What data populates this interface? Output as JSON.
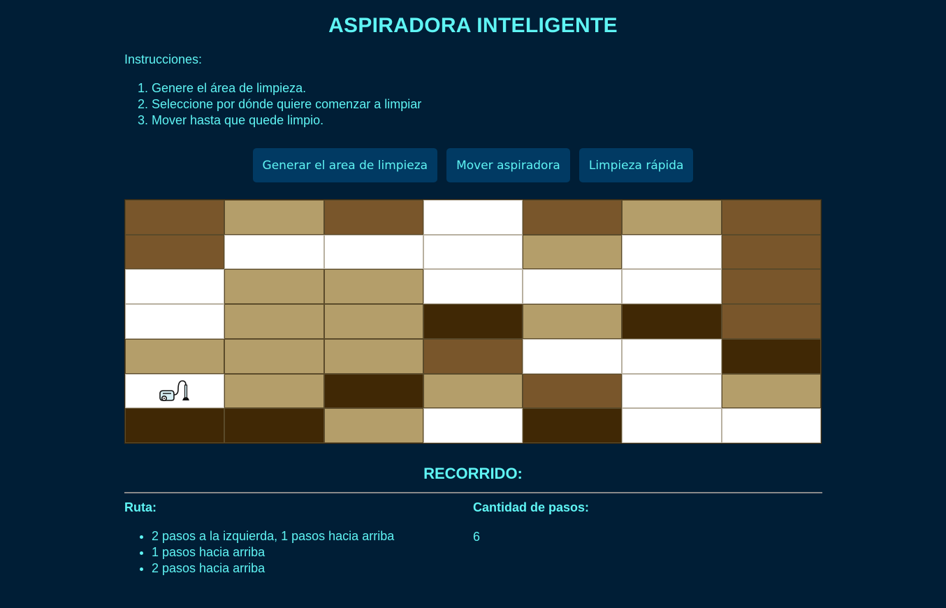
{
  "title": "ASPIRADORA INTELIGENTE",
  "instructions": {
    "label": "Instrucciones:",
    "steps": [
      "Genere el área de limpieza.",
      "Seleccione por dónde quiere comenzar a limpiar",
      "Mover hasta que quede limpio."
    ]
  },
  "buttons": {
    "generate": "Generar el area de limpieza",
    "move": "Mover aspiradora",
    "fast_clean": "Limpieza rápida"
  },
  "colors": {
    "background": "#001e36",
    "text": "#5ff4f4",
    "button_bg": "#013a63",
    "clean": "#ffffff",
    "light_dirt": "#b49e6a",
    "medium_dirt": "#79562b",
    "heavy_dirt": "#402805"
  },
  "grid": {
    "rows": [
      [
        "medium",
        "light",
        "medium",
        "clean",
        "medium",
        "light",
        "medium"
      ],
      [
        "medium",
        "clean",
        "clean",
        "clean",
        "light",
        "clean",
        "medium"
      ],
      [
        "clean",
        "light",
        "light",
        "clean",
        "clean",
        "clean",
        "medium"
      ],
      [
        "clean",
        "light",
        "light",
        "dark",
        "light",
        "dark",
        "medium"
      ],
      [
        "light",
        "light",
        "light",
        "medium",
        "clean",
        "clean",
        "dark"
      ],
      [
        "clean",
        "light",
        "dark",
        "light",
        "medium",
        "clean",
        "light"
      ],
      [
        "dark",
        "dark",
        "light",
        "clean",
        "dark",
        "clean",
        "clean"
      ]
    ],
    "vacuum": {
      "row": 5,
      "col": 0,
      "icon": "vacuum-cleaner-icon"
    }
  },
  "recorrido": {
    "title": "RECORRIDO:",
    "route_label": "Ruta:",
    "route": [
      "2 pasos a la izquierda, 1 pasos hacia arriba",
      "1 pasos hacia arriba",
      "2 pasos hacia arriba"
    ],
    "steps_label": "Cantidad de pasos:",
    "steps_count": "6"
  }
}
